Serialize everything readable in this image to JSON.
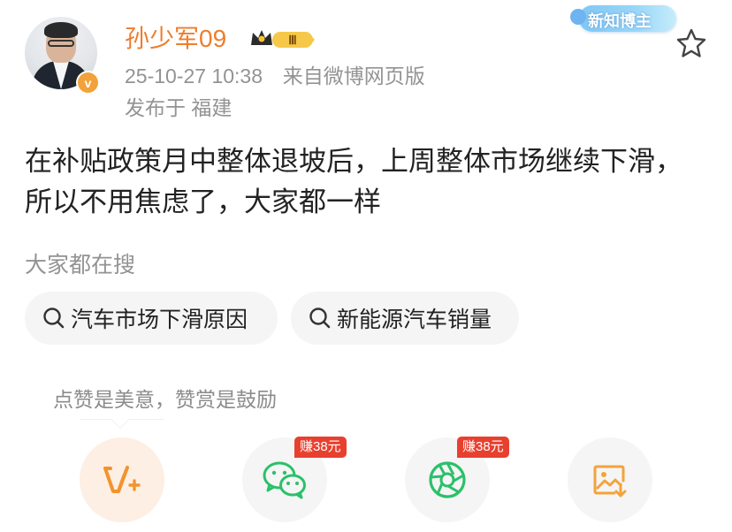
{
  "header": {
    "username": "孙少军09",
    "timestamp": "25-10-27 10:38",
    "source": "来自微博网页版",
    "location": "发布于 福建",
    "verified_mark": "v",
    "rank_badge": "Ⅲ",
    "new_badge": "新知博主"
  },
  "post": {
    "text": "在补贴政策月中整体退坡后，上周整体市场继续下滑，所以不用焦虑了，大家都一样"
  },
  "searches": {
    "title": "大家都在搜",
    "items": [
      {
        "label": "汽车市场下滑原因"
      },
      {
        "label": "新能源汽车销量"
      }
    ]
  },
  "support": {
    "tip": "点赞是美意，赞赏是鼓励",
    "actions": [
      {
        "icon": "vplus-icon"
      },
      {
        "icon": "wechat-icon",
        "badge": "赚38元"
      },
      {
        "icon": "moments-icon",
        "badge": "赚38元"
      },
      {
        "icon": "save-image-icon"
      }
    ]
  },
  "colors": {
    "username": "#f07c2c",
    "meta": "#939393",
    "badge_red": "#e8402f",
    "accent_orange": "#f2a23a",
    "wechat_green": "#2bc06a"
  }
}
